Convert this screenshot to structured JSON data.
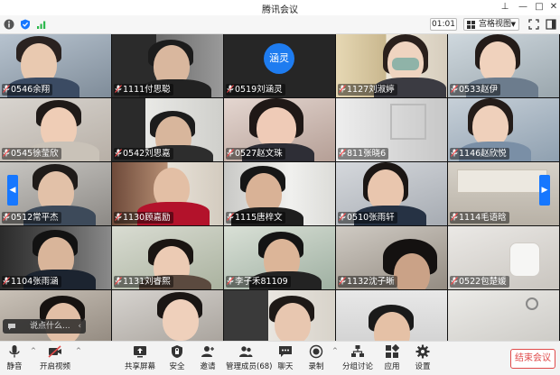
{
  "window": {
    "title": "腾讯会议"
  },
  "toolbar": {
    "timer": "01:01",
    "view_label": "宫格视图"
  },
  "participants": [
    "0546余翔",
    "1111付思聪",
    "0519刘涵灵",
    "1127刘淑婷",
    "0533赵伊",
    "0545徐莹欣",
    "0542刘思嘉",
    "0527赵文珠",
    "811张晓6",
    "1146赵欣悦",
    "0512常平杰",
    "1130顾嘉励",
    "1115唐梓文",
    "0510张雨轩",
    "1114毛语晗",
    "1104张雨涵",
    "1131刘睿熙",
    "李子禾81109",
    "1132沈子晰",
    "0522包楚媛"
  ],
  "avatar_label": "涵灵",
  "chat": {
    "placeholder": "说点什么..."
  },
  "bottombar": {
    "mute": "静音",
    "video": "开启视频",
    "share": "共享屏幕",
    "security": "安全",
    "invite": "邀请",
    "members": "管理成员(68)",
    "chat": "聊天",
    "record": "录制",
    "breakout": "分组讨论",
    "apps": "应用",
    "settings": "设置",
    "end": "结束会议"
  },
  "colors": {
    "accent": "#1677ff",
    "end": "#e04a4a",
    "avatar": "#1e7cf0"
  }
}
